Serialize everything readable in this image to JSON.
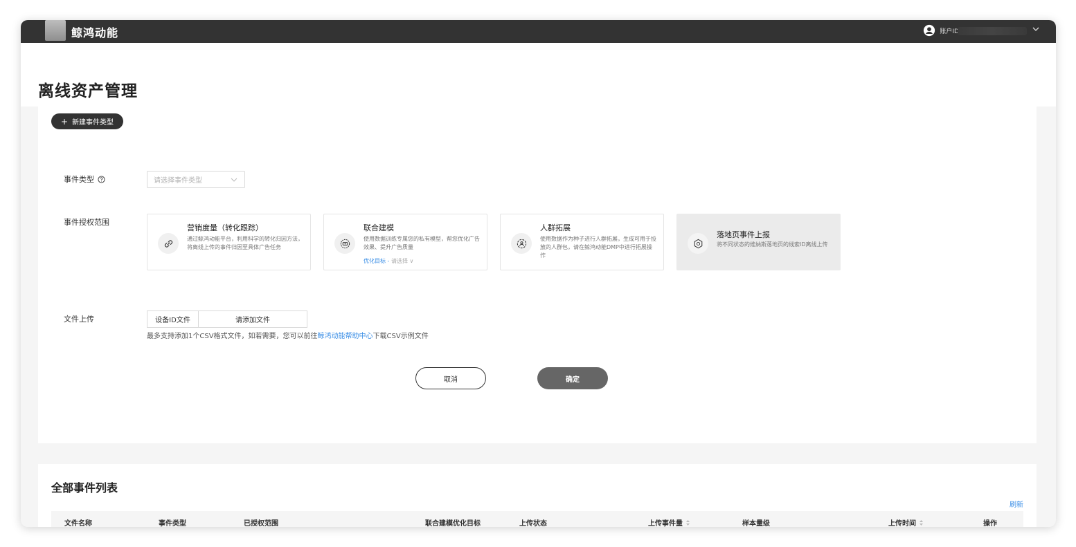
{
  "topbar": {
    "brand": "鲸鸿动能",
    "account_label": "账户ID"
  },
  "header": {
    "title": "离线资产管理"
  },
  "form": {
    "new_button": "新建事件类型",
    "event_type_label": "事件类型",
    "event_type_placeholder": "请选择事件类型",
    "scope_label": "事件授权范围",
    "cards": [
      {
        "title": "营销度量（转化跟踪）",
        "desc": "通过鲸鸿动能平台，利用科学的转化归因方法，将离线上传的事件归因至具体广告任务",
        "icon": "link-icon"
      },
      {
        "title": "联合建模",
        "desc": "使用数据训练专属您的私有模型，帮您优化广告效果、提升广告质量",
        "opt_label": "优化目标 -",
        "opt_placeholder": "请选择",
        "icon": "model-icon"
      },
      {
        "title": "人群拓展",
        "desc": "使用数据作为种子进行人群拓展，生成可用于投放的人群包，请在鲸鸿动能DMP中进行拓展操作",
        "icon": "audience-icon"
      },
      {
        "title": "落地页事件上报",
        "desc": "将不同状态的维纳斯落地页的线索ID离线上传",
        "icon": "landing-icon"
      }
    ],
    "upload_label": "文件上传",
    "upload_type": "设备ID文件",
    "upload_add": "请添加文件",
    "upload_note_prefix": "最多支持添加1个CSV格式文件，如若需要，您可以前往",
    "upload_note_link": "鲸鸿动能帮助中心",
    "upload_note_suffix": "下载CSV示例文件",
    "cancel": "取消",
    "confirm": "确定"
  },
  "list": {
    "title": "全部事件列表",
    "refresh": "刷新",
    "columns": [
      "文件名称",
      "事件类型",
      "已授权范围",
      "联合建模优化目标",
      "上传状态",
      "上传事件量",
      "样本量级",
      "上传时间",
      "操作"
    ]
  },
  "colors": {
    "accent": "#3a8ee6",
    "dark": "#333333"
  }
}
